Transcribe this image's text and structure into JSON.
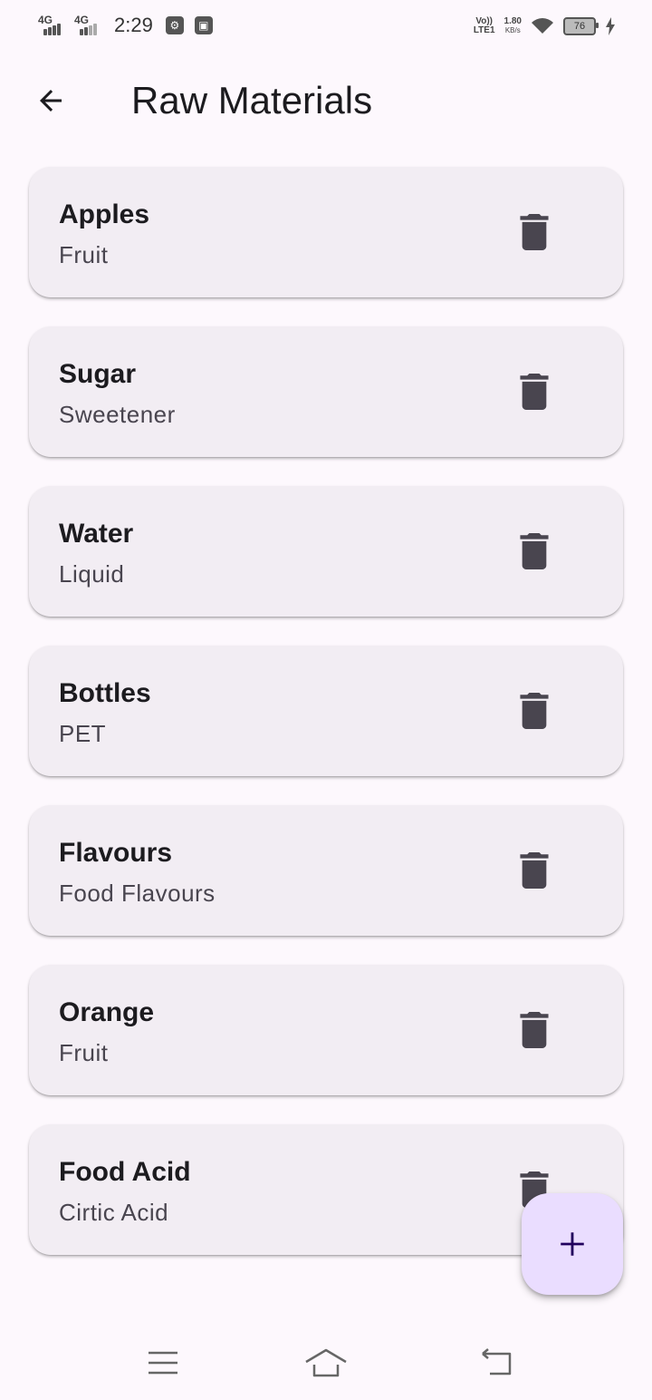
{
  "status_bar": {
    "sim1": "4G",
    "sim2": "4G",
    "time": "2:29",
    "volte": "Vo))",
    "lte": "LTE1",
    "speed_value": "1.80",
    "speed_unit": "KB/s",
    "battery": "76"
  },
  "header": {
    "title": "Raw Materials"
  },
  "materials": [
    {
      "name": "Apples",
      "category": "Fruit"
    },
    {
      "name": "Sugar",
      "category": "Sweetener"
    },
    {
      "name": "Water",
      "category": "Liquid"
    },
    {
      "name": "Bottles",
      "category": "PET"
    },
    {
      "name": "Flavours",
      "category": "Food Flavours"
    },
    {
      "name": "Orange",
      "category": "Fruit"
    },
    {
      "name": "Food Acid",
      "category": "Cirtic Acid"
    }
  ],
  "colors": {
    "background": "#fdf8fd",
    "card": "#f2edf3",
    "fab": "#eaddff",
    "fab_icon": "#21005d",
    "icon": "#49454f"
  },
  "icons": {
    "back": "arrow-back-icon",
    "delete": "trash-icon",
    "fab": "plus-icon",
    "nav_menu": "menu-icon",
    "nav_home": "home-icon",
    "nav_back": "back-nav-icon"
  }
}
